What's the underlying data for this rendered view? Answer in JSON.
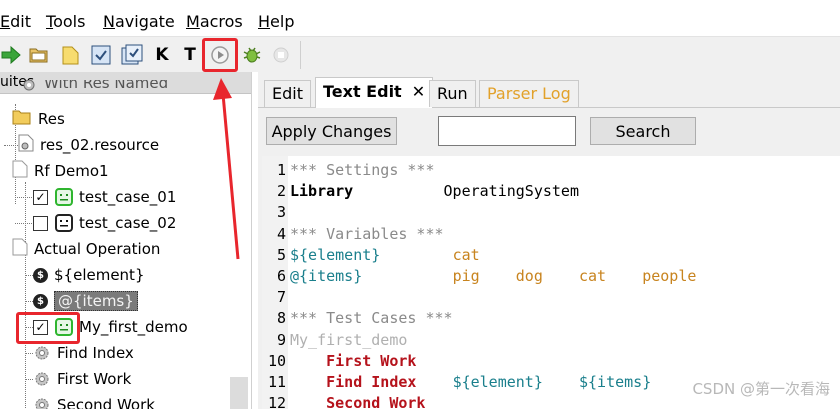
{
  "menu": {
    "items": [
      {
        "label": "Edit",
        "mnemonic": "E",
        "rest": "dit"
      },
      {
        "label": "Tools",
        "mnemonic": "T",
        "rest": "ools"
      },
      {
        "label": "Navigate",
        "mnemonic": "N",
        "rest": "avigate"
      },
      {
        "label": "Macros",
        "mnemonic": "M",
        "rest": "acros"
      },
      {
        "label": "Help",
        "mnemonic": "H",
        "rest": "elp"
      }
    ]
  },
  "toolbar": {
    "letter_k": "K",
    "letter_t": "T"
  },
  "tree": {
    "header": "uites",
    "items": [
      {
        "label": "With Res Named"
      },
      {
        "label": "Res"
      },
      {
        "label": "res_02.resource"
      },
      {
        "label": "Rf Demo1"
      },
      {
        "label": "test_case_01",
        "checked": true
      },
      {
        "label": "test_case_02",
        "checked": false
      },
      {
        "label": "Actual Operation"
      },
      {
        "label": "${element}"
      },
      {
        "label": "@{items}"
      },
      {
        "label": "My_first_demo",
        "checked": true
      },
      {
        "label": "Find Index"
      },
      {
        "label": "First Work"
      },
      {
        "label": "Second Work"
      }
    ]
  },
  "tabs": {
    "edit": "Edit",
    "text_edit": "Text Edit",
    "close": "✕",
    "run": "Run",
    "parser_log": "Parser Log"
  },
  "controls": {
    "apply_changes": "Apply Changes",
    "search_value": "",
    "search": "Search"
  },
  "editor": {
    "lines": [
      {
        "n": "1",
        "segments": [
          [
            "c-comment",
            "*** Settings ***"
          ]
        ]
      },
      {
        "n": "2",
        "segments": [
          [
            "c-kw",
            "Library"
          ],
          [
            "",
            "          "
          ],
          [
            "c-kwn",
            "OperatingSystem"
          ]
        ]
      },
      {
        "n": "3",
        "segments": []
      },
      {
        "n": "4",
        "segments": [
          [
            "c-comment",
            "*** Variables ***"
          ]
        ]
      },
      {
        "n": "5",
        "segments": [
          [
            "c-var",
            "${element}"
          ],
          [
            "",
            "        "
          ],
          [
            "c-val",
            "cat"
          ]
        ]
      },
      {
        "n": "6",
        "segments": [
          [
            "c-var",
            "@{items}"
          ],
          [
            "",
            "          "
          ],
          [
            "c-val",
            "pig    dog    cat    people"
          ]
        ]
      },
      {
        "n": "7",
        "segments": []
      },
      {
        "n": "8",
        "segments": [
          [
            "c-comment",
            "*** Test Cases ***"
          ]
        ]
      },
      {
        "n": "9",
        "segments": [
          [
            "c-tc",
            "My_first_demo"
          ]
        ]
      },
      {
        "n": "10",
        "segments": [
          [
            "",
            "    "
          ],
          [
            "c-step",
            "First Work"
          ]
        ]
      },
      {
        "n": "11",
        "segments": [
          [
            "",
            "    "
          ],
          [
            "c-step",
            "Find Index"
          ],
          [
            "",
            "    "
          ],
          [
            "c-var",
            "${element}"
          ],
          [
            "",
            "    "
          ],
          [
            "c-var",
            "${items}"
          ]
        ]
      },
      {
        "n": "12",
        "segments": [
          [
            "",
            "    "
          ],
          [
            "c-step",
            "Second Work"
          ]
        ]
      }
    ]
  },
  "watermark": "CSDN @第一次看海",
  "colors": {
    "annotation_red": "#e8262d",
    "robot_green": "#2fb52f",
    "step_red": "#b5121b",
    "variable_teal": "#1a7f8c",
    "value_orange": "#c8841f"
  }
}
